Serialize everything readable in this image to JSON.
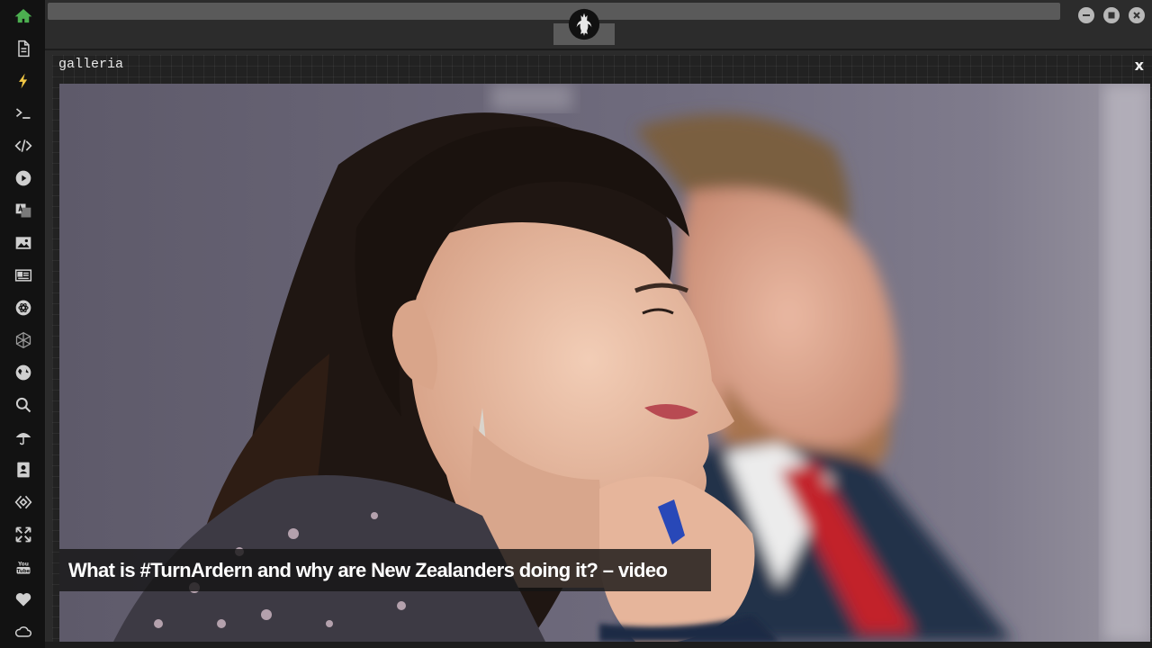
{
  "sidebar": {
    "items": [
      {
        "icon": "home-icon",
        "active": true
      },
      {
        "icon": "document-icon"
      },
      {
        "icon": "lightning-icon"
      },
      {
        "icon": "terminal-icon"
      },
      {
        "icon": "code-icon"
      },
      {
        "icon": "play-icon"
      },
      {
        "icon": "translate-icon"
      },
      {
        "icon": "image-icon"
      },
      {
        "icon": "newspaper-icon"
      },
      {
        "icon": "atom-icon"
      },
      {
        "icon": "hexagon-network-icon"
      },
      {
        "icon": "globe-icon"
      },
      {
        "icon": "search-icon"
      },
      {
        "icon": "umbrella-icon"
      },
      {
        "icon": "contacts-icon"
      },
      {
        "icon": "diamond-code-icon"
      },
      {
        "icon": "expand-icon"
      },
      {
        "icon": "youtube-icon"
      },
      {
        "icon": "heart-icon"
      },
      {
        "icon": "cloud-icon"
      }
    ]
  },
  "topbar": {
    "address_value": "",
    "logo_icon": "rebel-alliance-logo",
    "window_controls": [
      "minimize-icon",
      "maximize-icon",
      "close-icon"
    ]
  },
  "window": {
    "title": "galleria",
    "close_label": "x"
  },
  "gallery": {
    "caption": "What is #TurnArdern and why are New Zealanders doing it? – video"
  },
  "colors": {
    "accent": "#4caf50",
    "sidebar_bg": "#121212",
    "panel_bg": "#222222",
    "address_bar": "#5a5a5a"
  }
}
